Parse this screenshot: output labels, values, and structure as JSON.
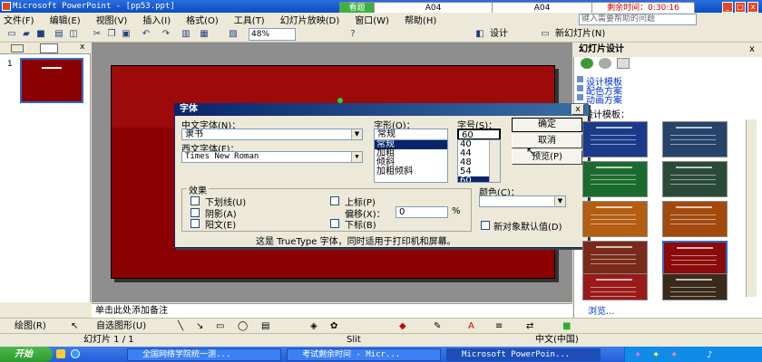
{
  "window": {
    "title": "Microsoft PowerPoint - [pp53.ppt]",
    "min": "_",
    "max": "□",
    "close": "x"
  },
  "exam_bar": {
    "view": "看题",
    "code1": "A04",
    "code2": "A04",
    "remaining": "剩余时间：0:30:16"
  },
  "menu": [
    "文件(F)",
    "编辑(E)",
    "视图(V)",
    "插入(I)",
    "格式(O)",
    "工具(T)",
    "幻灯片放映(D)",
    "窗口(W)",
    "帮助(H)"
  ],
  "help_placeholder": "键入需要帮助的问题",
  "toolbar": {
    "zoom": "48%",
    "design": "设计",
    "new_slide": "新幻灯片(N)"
  },
  "thumbnails": {
    "number": "1"
  },
  "notes_placeholder": "单击此处添加备注",
  "task_pane": {
    "title": "幻灯片设计",
    "links": [
      "设计模板",
      "配色方案",
      "动画方案"
    ],
    "section": "用设计模板：",
    "template_colors": [
      "#1b3a8a",
      "#26436b",
      "#1c6b2e",
      "#2a4a3a",
      "#b35e12",
      "#a24a0e",
      "#7a2a1a",
      "#8b0a0a",
      "#9a1a1a",
      "#3a2a1a"
    ],
    "browse": "浏览..."
  },
  "dialog": {
    "title": "字体",
    "close": "x",
    "cn_font_label": "中文字体(N)：",
    "cn_font_value": "隶书",
    "west_font_label": "西文字体(F)：",
    "west_font_value": "Times New Roman",
    "style_label": "字形(O)：",
    "style_value": "常规",
    "style_options": [
      "常规",
      "加粗",
      "倾斜",
      "加粗倾斜"
    ],
    "size_label": "字号(S)：",
    "size_value": "60",
    "size_options": [
      "40",
      "44",
      "48",
      "54",
      "60"
    ],
    "ok": "确定",
    "cancel": "取消",
    "preview": "预览(P)",
    "effects_label": "效果",
    "effects": [
      "下划线(U)",
      "阴影(A)",
      "阳文(E)",
      "上标(P)",
      "下标(B)"
    ],
    "offset_label": "偏移(X)：",
    "offset_value": "0",
    "offset_unit": "%",
    "color_label": "颜色(C)：",
    "default_label": "新对象默认值(D)",
    "note": "这是 TrueType 字体，同时适用于打印机和屏幕。"
  },
  "drawbar": {
    "draw": "绘图(R)",
    "autoshapes": "自选图形(U)"
  },
  "status": {
    "slide": "幻灯片 1 / 1",
    "design": "Slit",
    "lang": "中文(中国)"
  },
  "taskbar": {
    "start": "开始",
    "items": [
      "全国网络学院统一测...",
      "考试剩余时间 - Micr...",
      "Microsoft PowerPoin..."
    ]
  }
}
